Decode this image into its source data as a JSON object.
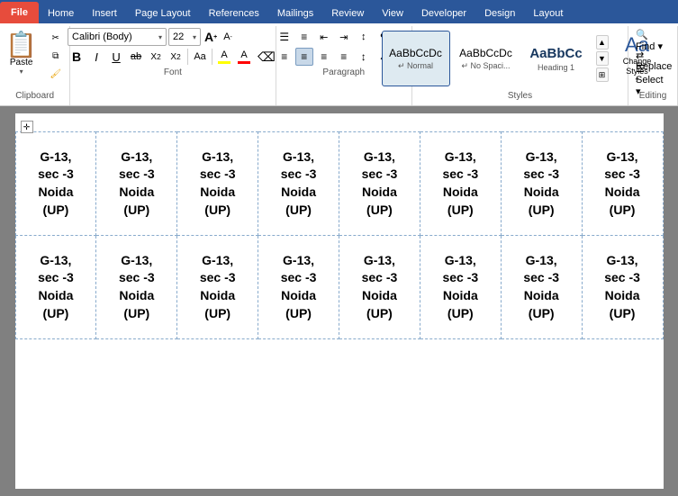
{
  "tabs": {
    "file": "File",
    "home": "Home",
    "insert": "Insert",
    "page_layout": "Page Layout",
    "references": "References",
    "mailings": "Mailings",
    "review": "Review",
    "view": "View",
    "developer": "Developer",
    "design": "Design",
    "layout": "Layout"
  },
  "clipboard": {
    "label": "Clipboard",
    "paste_label": "Paste",
    "cut_label": "✂",
    "copy_label": "⧉",
    "format_painter_label": "🖌"
  },
  "font": {
    "label": "Font",
    "name": "Calibri (Body)",
    "size": "22",
    "bold": "B",
    "italic": "I",
    "underline": "U",
    "strikethrough": "ab",
    "subscript": "X₂",
    "superscript": "X²",
    "change_case": "Aa",
    "text_highlight": "A",
    "font_color": "A",
    "clear_format": "⌫",
    "grow": "A",
    "shrink": "A"
  },
  "paragraph": {
    "label": "Paragraph"
  },
  "styles": {
    "label": "Styles",
    "normal_label": "↵ Normal",
    "no_spacing_label": "↵ No Spaci...",
    "heading1_label": "Heading 1",
    "normal_preview": "AaBbCcDc",
    "no_spacing_preview": "AaBbCcDc",
    "heading1_preview": "AaBbCc"
  },
  "change_styles": {
    "label": "Change\nStyles",
    "icon": "⌄"
  },
  "editing": {
    "label": "Editing"
  },
  "table_content": "G-13,\nsec -3\nNoida\n(UP)",
  "cell_text": {
    "line1": "G-13,",
    "line2": "sec -3",
    "line3": "Noida",
    "line4": "(UP)"
  }
}
